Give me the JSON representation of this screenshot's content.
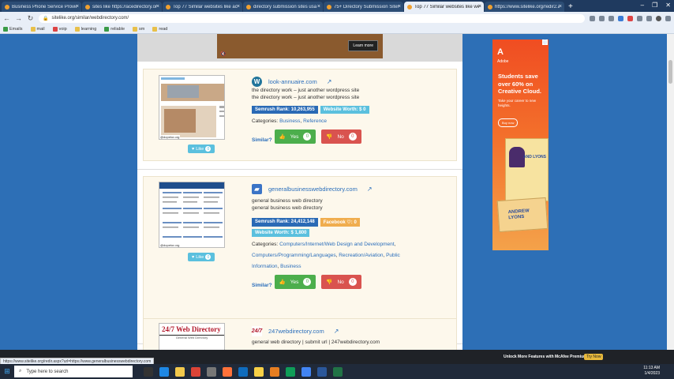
{
  "browser": {
    "tabs": [
      {
        "label": "Business Phone Service Provider",
        "active": false
      },
      {
        "label": "sites like https://acedirectory.or",
        "active": false
      },
      {
        "label": "Top 77 Similar websites like acer",
        "active": false
      },
      {
        "label": "directory submission sites usa 2",
        "active": false
      },
      {
        "label": "75+ Directory Submission Sites",
        "active": false
      },
      {
        "label": "Top 77 Similar websites like we",
        "active": true
      },
      {
        "label": "https://www.sitelike.org/redir2.a",
        "active": false
      }
    ],
    "new_tab": "+",
    "url": "sitelike.org/similar/webdirectory.com/",
    "bookmarks": [
      {
        "label": "Emails",
        "icon": "grid-icon"
      },
      {
        "label": "mail",
        "icon": "person-icon"
      },
      {
        "label": "voip",
        "icon": "voip-icon"
      },
      {
        "label": "learning",
        "icon": "folder-icon"
      },
      {
        "label": "reliable",
        "icon": "bookmark-icon"
      },
      {
        "label": "sm",
        "icon": "folder-icon"
      },
      {
        "label": "read",
        "icon": "folder-icon"
      }
    ]
  },
  "video": {
    "cta": "Learn more",
    "mute_icon": "🔇"
  },
  "listings": [
    {
      "site": "look-annuaire.com",
      "logo": "W",
      "desc": [
        "the directory work – just another wordpress site",
        "the directory work – just another wordpress site"
      ],
      "semrush": "Semrush Rank: 10,263,955",
      "worth": "Website Worth: $ 0",
      "facebook": "",
      "categories_label": "Categories:",
      "categories": [
        "Business",
        "Reference"
      ],
      "like_label": "Like",
      "like_count": "0",
      "thumb_tag": "@dopetor.org",
      "similar_label": "Similar?",
      "yes_label": "Yes",
      "yes_count": "0",
      "no_label": "No",
      "no_count": "0"
    },
    {
      "site": "generalbusinesswebdirectory.com",
      "logo": "▰",
      "desc": [
        "general business web directory",
        "general business web directory"
      ],
      "semrush": "Semrush Rank: 24,412,148",
      "worth": "Website Worth: $ 1,800",
      "facebook": "Facebook ♡: 0",
      "categories_label": "Categories:",
      "categories": [
        "Computers/Internet/Web Design and Development",
        "Computers/Programming/Languages",
        "Recreation/Aviation",
        "Public Information",
        "Business"
      ],
      "like_label": "Like",
      "like_count": "0",
      "thumb_tag": "@dopetor.org",
      "similar_label": "Similar?",
      "yes_label": "Yes",
      "yes_count": "0",
      "no_label": "No",
      "no_count": "0"
    },
    {
      "site": "247webdirectory.com",
      "logo": "24/7",
      "desc": [
        "general web directory | submit url | 247webdirectory.com"
      ],
      "thumb_title": "24/7 Web Directory",
      "thumb_sub": "General Web Directory"
    }
  ],
  "ad": {
    "logo": "A",
    "brand": "Adobe",
    "headline": "Students save over 60% on Creative Cloud.",
    "subtext": "Take your career to new heights.",
    "cta": "Buy now",
    "book1_name": "AND LYONS",
    "book2_name": "ANDREW LYONS"
  },
  "status_url": "https://www.sitelike.org/redir.aspx?url=https://www.generalbusinesswebdirectory.com",
  "bottom_bar": {
    "promo": "Unlock More Features with McAfee Premium",
    "try": "Try Now"
  },
  "taskbar": {
    "search_placeholder": "Type here to search",
    "time": "11:13 AM",
    "date": "1/4/2023"
  },
  "colors": {
    "page_bg": "#2d6fb6",
    "card_bg": "#fdf8ec",
    "link": "#2a6ebb",
    "yes": "#4cae4c",
    "no": "#d9534f"
  }
}
